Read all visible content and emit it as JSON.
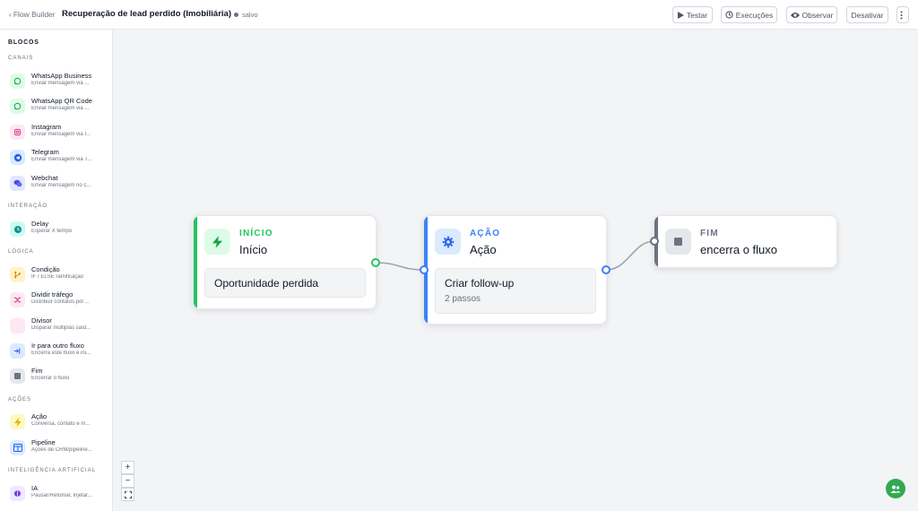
{
  "header": {
    "back_label": "Flow Builder",
    "title": "Recuperação de lead perdido (Imobiliária)",
    "status": "salvo",
    "buttons": {
      "test": "Testar",
      "executions": "Execuções",
      "observe": "Observar",
      "deactivate": "Desativar"
    }
  },
  "sidebar": {
    "heading": "BLOCOS",
    "sections": {
      "channels": "CANAIS",
      "interaction": "INTERAÇÃO",
      "logic": "LÓGICA",
      "actions": "AÇÕES",
      "ai": "INTELIGÊNCIA ARTIFICIAL"
    },
    "items": [
      {
        "name": "WhatsApp Business",
        "desc": "Enviar mensagem via ..."
      },
      {
        "name": "WhatsApp QR Code",
        "desc": "Enviar mensagem via ..."
      },
      {
        "name": "Instagram",
        "desc": "Enviar mensagem via I..."
      },
      {
        "name": "Telegram",
        "desc": "Enviar mensagem via T..."
      },
      {
        "name": "Webchat",
        "desc": "Enviar mensagem no c..."
      },
      {
        "name": "Delay",
        "desc": "Esperar X tempo"
      },
      {
        "name": "Condição",
        "desc": "IF / ELSE ramificação"
      },
      {
        "name": "Dividir tráfego",
        "desc": "Distribuir contatos por ..."
      },
      {
        "name": "Divisor",
        "desc": "Disparar múltiplas saíd..."
      },
      {
        "name": "Ir para outro fluxo",
        "desc": "Encerra este fluxo e ini..."
      },
      {
        "name": "Fim",
        "desc": "Encerrar o fluxo"
      },
      {
        "name": "Ação",
        "desc": "Conversa, contato e m..."
      },
      {
        "name": "Pipeline",
        "desc": "Ações de CRM/pipeline..."
      },
      {
        "name": "IA",
        "desc": "Pausar/Retomar, injetar..."
      }
    ]
  },
  "canvas": {
    "nodes": [
      {
        "kind": "INÍCIO",
        "label": "Início",
        "inner_title": "Oportunidade perdida",
        "color": "#22c55e"
      },
      {
        "kind": "AÇÃO",
        "label": "Ação",
        "inner_title": "Criar follow-up",
        "inner_sub": "2 passos",
        "color": "#3b82f6"
      },
      {
        "kind": "FIM",
        "label": "encerra o fluxo",
        "color": "#6b7280"
      }
    ],
    "zoom": {
      "in": "+",
      "out": "−"
    }
  },
  "colors": {
    "accent_green": "#22c55e",
    "accent_blue": "#3b82f6",
    "end_gray": "#6b7280",
    "canvas_bg": "#f3f4f6"
  }
}
